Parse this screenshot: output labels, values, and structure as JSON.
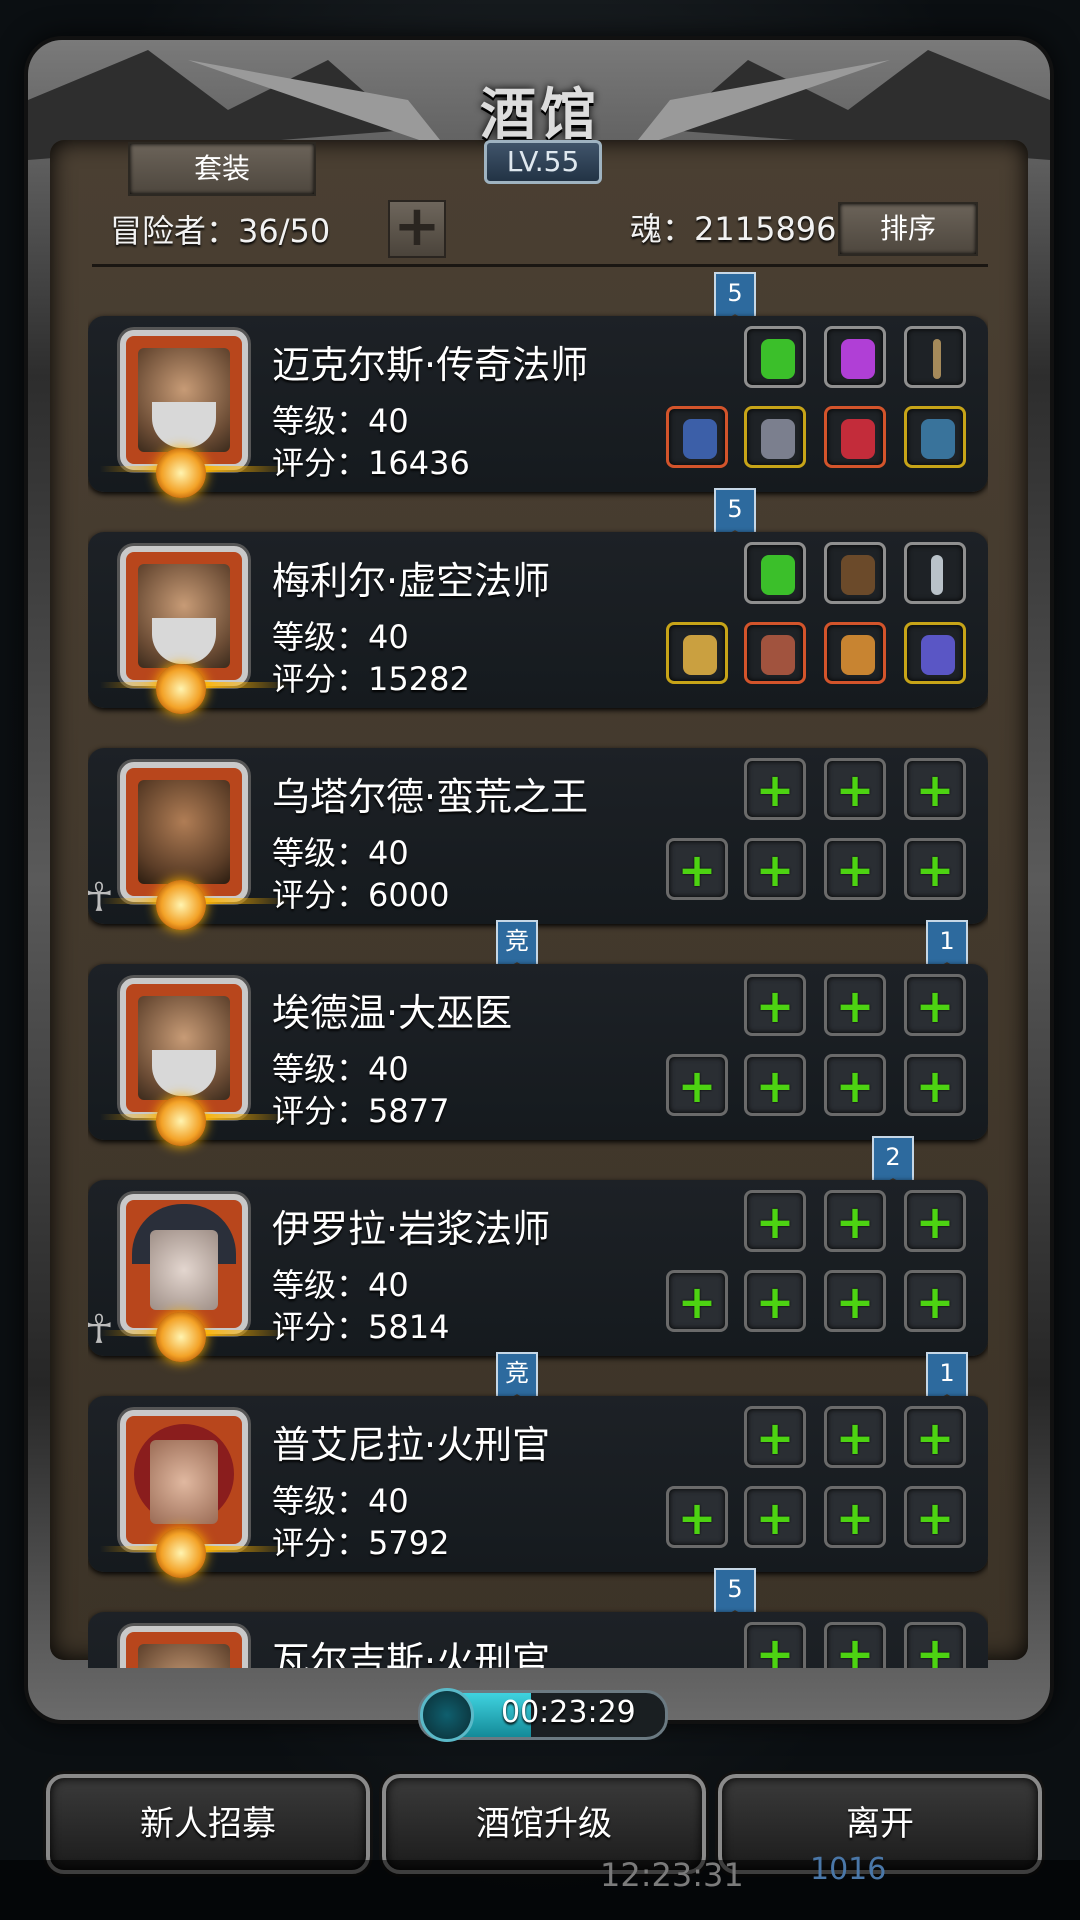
{
  "header": {
    "title": "酒馆",
    "level_badge": "LV.55",
    "set_button": "套装",
    "adventurers_label": "冒险者：36/50",
    "soul_label": "魂：2115896",
    "sort_button": "排序"
  },
  "cards": [
    {
      "name": "迈克尔斯·传奇法师",
      "level": "等级：40",
      "score": "评分：16436",
      "ribbon": "5",
      "avatar": "wizard",
      "equipment": [
        "green-crystal",
        "purple-gem",
        "staff",
        "spear",
        "armor",
        "potion",
        "amulet"
      ]
    },
    {
      "name": "梅利尔·虚空法师",
      "level": "等级：40",
      "score": "评分：15282",
      "ribbon": "5",
      "avatar": "wizard",
      "equipment": [
        "green-crystal",
        "500-medal",
        "dagger",
        "mace",
        "fighter",
        "gem",
        "bracelet"
      ]
    },
    {
      "name": "乌塔尔德·蛮荒之王",
      "level": "等级：40",
      "score": "评分：6000",
      "ribbon": "",
      "avatar": "brute",
      "equipment": []
    },
    {
      "name": "埃德温·大巫医",
      "level": "等级：40",
      "score": "评分：5877",
      "ribbon": "竞",
      "ribbon_right": "1",
      "avatar": "wizard",
      "equipment": []
    },
    {
      "name": "伊罗拉·岩浆法师",
      "level": "等级：40",
      "score": "评分：5814",
      "ribbon": "",
      "ribbon_right": "2",
      "avatar": "hooded",
      "equipment": []
    },
    {
      "name": "普艾尼拉·火刑官",
      "level": "等级：40",
      "score": "评分：5792",
      "ribbon": "竞",
      "ribbon_right": "1",
      "avatar": "redhair",
      "equipment": []
    },
    {
      "name": "瓦尔吉斯·火刑官",
      "level": "",
      "score": "",
      "ribbon": "5",
      "avatar": "wizard",
      "equipment": []
    }
  ],
  "footer": {
    "timer": "00:23:29",
    "timer_progress": 0.45,
    "recruit_button": "新人招募",
    "upgrade_button": "酒馆升级",
    "leave_button": "离开",
    "status_time": "12:23:31",
    "status_gold": "1016"
  },
  "colors": {
    "accent_green": "#4dd312",
    "ribbon_blue": "#2d6a9e",
    "timer_cyan": "#3fd3e0"
  }
}
